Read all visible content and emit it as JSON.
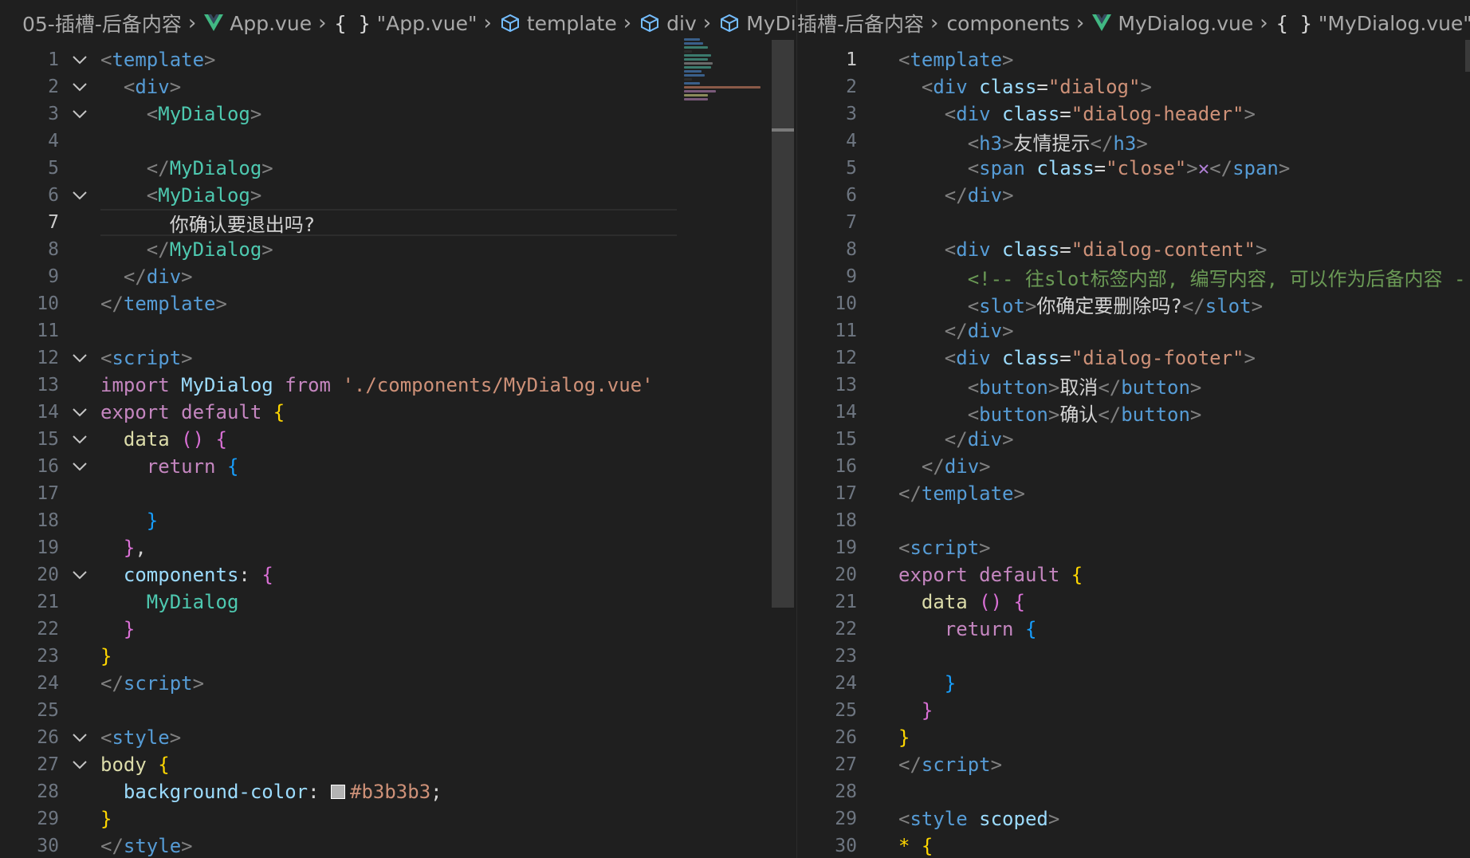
{
  "left": {
    "breadcrumbs": [
      "05-插槽-后备内容",
      "App.vue",
      "\"App.vue\"",
      "template",
      "div",
      "MyDi"
    ],
    "current_line": 7
  },
  "right": {
    "breadcrumbs": [
      "插槽-后备内容",
      "components",
      "MyDialog.vue",
      "\"MyDialog.vue\""
    ],
    "current_line": 1
  },
  "swatch_color": "#b3b3b3",
  "colors": {
    "background": "#1f1f1f",
    "line_number": "#6e7681",
    "tag": "#569cd6",
    "component": "#4ec9b0",
    "attribute": "#9cdcfe",
    "string": "#ce9178",
    "keyword": "#c586c0",
    "comment": "#6a9955"
  },
  "left_lines": [
    {
      "n": "1",
      "fold": true,
      "tokens": [
        [
          "t-punc",
          "<"
        ],
        [
          "t-tag",
          "template"
        ],
        [
          "t-punc",
          ">"
        ]
      ]
    },
    {
      "n": "2",
      "fold": true,
      "tokens": [
        [
          "t-white",
          "  "
        ],
        [
          "t-punc",
          "<"
        ],
        [
          "t-tag",
          "div"
        ],
        [
          "t-punc",
          ">"
        ]
      ]
    },
    {
      "n": "3",
      "fold": true,
      "tokens": [
        [
          "t-white",
          "    "
        ],
        [
          "t-punc",
          "<"
        ],
        [
          "t-comp",
          "MyDialog"
        ],
        [
          "t-punc",
          ">"
        ]
      ]
    },
    {
      "n": "4",
      "fold": false,
      "tokens": []
    },
    {
      "n": "5",
      "fold": false,
      "tokens": [
        [
          "t-white",
          "    "
        ],
        [
          "t-punc",
          "</"
        ],
        [
          "t-comp",
          "MyDialog"
        ],
        [
          "t-punc",
          ">"
        ]
      ]
    },
    {
      "n": "6",
      "fold": true,
      "tokens": [
        [
          "t-white",
          "    "
        ],
        [
          "t-punc",
          "<"
        ],
        [
          "t-comp",
          "MyDialog"
        ],
        [
          "t-punc",
          ">"
        ]
      ]
    },
    {
      "n": "7",
      "fold": false,
      "tokens": [
        [
          "t-white",
          "      "
        ],
        [
          "t-text",
          "你确认要退出吗?"
        ]
      ]
    },
    {
      "n": "8",
      "fold": false,
      "tokens": [
        [
          "t-white",
          "    "
        ],
        [
          "t-punc",
          "</"
        ],
        [
          "t-comp",
          "MyDialog"
        ],
        [
          "t-punc",
          ">"
        ]
      ]
    },
    {
      "n": "9",
      "fold": false,
      "tokens": [
        [
          "t-white",
          "  "
        ],
        [
          "t-punc",
          "</"
        ],
        [
          "t-tag",
          "div"
        ],
        [
          "t-punc",
          ">"
        ]
      ]
    },
    {
      "n": "10",
      "fold": false,
      "tokens": [
        [
          "t-punc",
          "</"
        ],
        [
          "t-tag",
          "template"
        ],
        [
          "t-punc",
          ">"
        ]
      ]
    },
    {
      "n": "11",
      "fold": false,
      "tokens": []
    },
    {
      "n": "12",
      "fold": true,
      "tokens": [
        [
          "t-punc",
          "<"
        ],
        [
          "t-tag",
          "script"
        ],
        [
          "t-punc",
          ">"
        ]
      ]
    },
    {
      "n": "13",
      "fold": false,
      "tokens": [
        [
          "t-kw",
          "import "
        ],
        [
          "t-attr",
          "MyDialog "
        ],
        [
          "t-kw",
          "from "
        ],
        [
          "t-str",
          "'./components/MyDialog.vue'"
        ]
      ]
    },
    {
      "n": "14",
      "fold": true,
      "tokens": [
        [
          "t-kw",
          "export default "
        ],
        [
          "t-b1",
          "{"
        ]
      ]
    },
    {
      "n": "15",
      "fold": true,
      "tokens": [
        [
          "t-white",
          "  "
        ],
        [
          "t-fn",
          "data "
        ],
        [
          "t-b2",
          "()"
        ],
        [
          "t-white",
          " "
        ],
        [
          "t-b2",
          "{"
        ]
      ]
    },
    {
      "n": "16",
      "fold": true,
      "tokens": [
        [
          "t-white",
          "    "
        ],
        [
          "t-kw",
          "return "
        ],
        [
          "t-b3",
          "{"
        ]
      ]
    },
    {
      "n": "17",
      "fold": false,
      "tokens": []
    },
    {
      "n": "18",
      "fold": false,
      "tokens": [
        [
          "t-white",
          "    "
        ],
        [
          "t-b3",
          "}"
        ]
      ]
    },
    {
      "n": "19",
      "fold": false,
      "tokens": [
        [
          "t-white",
          "  "
        ],
        [
          "t-b2",
          "}"
        ],
        [
          "t-white",
          ","
        ]
      ]
    },
    {
      "n": "20",
      "fold": true,
      "tokens": [
        [
          "t-white",
          "  "
        ],
        [
          "t-prop",
          "components"
        ],
        [
          "t-white",
          ": "
        ],
        [
          "t-b2",
          "{"
        ]
      ]
    },
    {
      "n": "21",
      "fold": false,
      "tokens": [
        [
          "t-white",
          "    "
        ],
        [
          "t-comp",
          "MyDialog"
        ]
      ]
    },
    {
      "n": "22",
      "fold": false,
      "tokens": [
        [
          "t-white",
          "  "
        ],
        [
          "t-b2",
          "}"
        ]
      ]
    },
    {
      "n": "23",
      "fold": false,
      "tokens": [
        [
          "t-b1",
          "}"
        ]
      ]
    },
    {
      "n": "24",
      "fold": false,
      "tokens": [
        [
          "t-punc",
          "</"
        ],
        [
          "t-tag",
          "script"
        ],
        [
          "t-punc",
          ">"
        ]
      ]
    },
    {
      "n": "25",
      "fold": false,
      "tokens": []
    },
    {
      "n": "26",
      "fold": true,
      "tokens": [
        [
          "t-punc",
          "<"
        ],
        [
          "t-tag",
          "style"
        ],
        [
          "t-punc",
          ">"
        ]
      ]
    },
    {
      "n": "27",
      "fold": true,
      "tokens": [
        [
          "t-fn",
          "body "
        ],
        [
          "t-b1",
          "{"
        ]
      ]
    },
    {
      "n": "28",
      "fold": false,
      "tokens": [
        [
          "t-white",
          "  "
        ],
        [
          "t-prop",
          "background-color"
        ],
        [
          "t-white",
          ": "
        ],
        [
          "swatch",
          ""
        ],
        [
          "t-str",
          "#b3b3b3"
        ],
        [
          "t-white",
          ";"
        ]
      ]
    },
    {
      "n": "29",
      "fold": false,
      "tokens": [
        [
          "t-b1",
          "}"
        ]
      ]
    },
    {
      "n": "30",
      "fold": false,
      "tokens": [
        [
          "t-punc",
          "</"
        ],
        [
          "t-tag",
          "style"
        ],
        [
          "t-punc",
          ">"
        ]
      ]
    }
  ],
  "right_lines": [
    {
      "n": "1",
      "tokens": [
        [
          "t-punc",
          "<"
        ],
        [
          "t-tag",
          "template"
        ],
        [
          "t-punc",
          ">"
        ]
      ]
    },
    {
      "n": "2",
      "tokens": [
        [
          "t-white",
          "  "
        ],
        [
          "t-punc",
          "<"
        ],
        [
          "t-tag",
          "div "
        ],
        [
          "t-attr",
          "class"
        ],
        [
          "t-white",
          "="
        ],
        [
          "t-str",
          "\"dialog\""
        ],
        [
          "t-punc",
          ">"
        ]
      ]
    },
    {
      "n": "3",
      "tokens": [
        [
          "t-white",
          "    "
        ],
        [
          "t-punc",
          "<"
        ],
        [
          "t-tag",
          "div "
        ],
        [
          "t-attr",
          "class"
        ],
        [
          "t-white",
          "="
        ],
        [
          "t-str",
          "\"dialog-header\""
        ],
        [
          "t-punc",
          ">"
        ]
      ]
    },
    {
      "n": "4",
      "tokens": [
        [
          "t-white",
          "      "
        ],
        [
          "t-punc",
          "<"
        ],
        [
          "t-tag",
          "h3"
        ],
        [
          "t-punc",
          ">"
        ],
        [
          "t-text",
          "友情提示"
        ],
        [
          "t-punc",
          "</"
        ],
        [
          "t-tag",
          "h3"
        ],
        [
          "t-punc",
          ">"
        ]
      ]
    },
    {
      "n": "5",
      "tokens": [
        [
          "t-white",
          "      "
        ],
        [
          "t-punc",
          "<"
        ],
        [
          "t-tag",
          "span "
        ],
        [
          "t-attr",
          "class"
        ],
        [
          "t-white",
          "="
        ],
        [
          "t-str",
          "\"close\""
        ],
        [
          "t-punc",
          ">"
        ],
        [
          "t-close",
          "✕"
        ],
        [
          "t-punc",
          "</"
        ],
        [
          "t-tag",
          "span"
        ],
        [
          "t-punc",
          ">"
        ]
      ]
    },
    {
      "n": "6",
      "tokens": [
        [
          "t-white",
          "    "
        ],
        [
          "t-punc",
          "</"
        ],
        [
          "t-tag",
          "div"
        ],
        [
          "t-punc",
          ">"
        ]
      ]
    },
    {
      "n": "7",
      "tokens": []
    },
    {
      "n": "8",
      "tokens": [
        [
          "t-white",
          "    "
        ],
        [
          "t-punc",
          "<"
        ],
        [
          "t-tag",
          "div "
        ],
        [
          "t-attr",
          "class"
        ],
        [
          "t-white",
          "="
        ],
        [
          "t-str",
          "\"dialog-content\""
        ],
        [
          "t-punc",
          ">"
        ]
      ]
    },
    {
      "n": "9",
      "tokens": [
        [
          "t-white",
          "      "
        ],
        [
          "t-cmt",
          "<!-- 往slot标签内部, 编写内容, 可以作为后备内容 -"
        ]
      ]
    },
    {
      "n": "10",
      "tokens": [
        [
          "t-white",
          "      "
        ],
        [
          "t-punc",
          "<"
        ],
        [
          "t-tag",
          "slot"
        ],
        [
          "t-punc",
          ">"
        ],
        [
          "t-text",
          "你确定要删除吗?"
        ],
        [
          "t-punc",
          "</"
        ],
        [
          "t-tag",
          "slot"
        ],
        [
          "t-punc",
          ">"
        ]
      ]
    },
    {
      "n": "11",
      "tokens": [
        [
          "t-white",
          "    "
        ],
        [
          "t-punc",
          "</"
        ],
        [
          "t-tag",
          "div"
        ],
        [
          "t-punc",
          ">"
        ]
      ]
    },
    {
      "n": "12",
      "tokens": [
        [
          "t-white",
          "    "
        ],
        [
          "t-punc",
          "<"
        ],
        [
          "t-tag",
          "div "
        ],
        [
          "t-attr",
          "class"
        ],
        [
          "t-white",
          "="
        ],
        [
          "t-str",
          "\"dialog-footer\""
        ],
        [
          "t-punc",
          ">"
        ]
      ]
    },
    {
      "n": "13",
      "tokens": [
        [
          "t-white",
          "      "
        ],
        [
          "t-punc",
          "<"
        ],
        [
          "t-tag",
          "button"
        ],
        [
          "t-punc",
          ">"
        ],
        [
          "t-text",
          "取消"
        ],
        [
          "t-punc",
          "</"
        ],
        [
          "t-tag",
          "button"
        ],
        [
          "t-punc",
          ">"
        ]
      ]
    },
    {
      "n": "14",
      "tokens": [
        [
          "t-white",
          "      "
        ],
        [
          "t-punc",
          "<"
        ],
        [
          "t-tag",
          "button"
        ],
        [
          "t-punc",
          ">"
        ],
        [
          "t-text",
          "确认"
        ],
        [
          "t-punc",
          "</"
        ],
        [
          "t-tag",
          "button"
        ],
        [
          "t-punc",
          ">"
        ]
      ]
    },
    {
      "n": "15",
      "tokens": [
        [
          "t-white",
          "    "
        ],
        [
          "t-punc",
          "</"
        ],
        [
          "t-tag",
          "div"
        ],
        [
          "t-punc",
          ">"
        ]
      ]
    },
    {
      "n": "16",
      "tokens": [
        [
          "t-white",
          "  "
        ],
        [
          "t-punc",
          "</"
        ],
        [
          "t-tag",
          "div"
        ],
        [
          "t-punc",
          ">"
        ]
      ]
    },
    {
      "n": "17",
      "tokens": [
        [
          "t-punc",
          "</"
        ],
        [
          "t-tag",
          "template"
        ],
        [
          "t-punc",
          ">"
        ]
      ]
    },
    {
      "n": "18",
      "tokens": []
    },
    {
      "n": "19",
      "tokens": [
        [
          "t-punc",
          "<"
        ],
        [
          "t-tag",
          "script"
        ],
        [
          "t-punc",
          ">"
        ]
      ]
    },
    {
      "n": "20",
      "tokens": [
        [
          "t-kw",
          "export default "
        ],
        [
          "t-b1",
          "{"
        ]
      ]
    },
    {
      "n": "21",
      "tokens": [
        [
          "t-white",
          "  "
        ],
        [
          "t-fn",
          "data "
        ],
        [
          "t-b2",
          "()"
        ],
        [
          "t-white",
          " "
        ],
        [
          "t-b2",
          "{"
        ]
      ]
    },
    {
      "n": "22",
      "tokens": [
        [
          "t-white",
          "    "
        ],
        [
          "t-kw",
          "return "
        ],
        [
          "t-b3",
          "{"
        ]
      ]
    },
    {
      "n": "23",
      "tokens": []
    },
    {
      "n": "24",
      "tokens": [
        [
          "t-white",
          "    "
        ],
        [
          "t-b3",
          "}"
        ]
      ]
    },
    {
      "n": "25",
      "tokens": [
        [
          "t-white",
          "  "
        ],
        [
          "t-b2",
          "}"
        ]
      ]
    },
    {
      "n": "26",
      "tokens": [
        [
          "t-b1",
          "}"
        ]
      ]
    },
    {
      "n": "27",
      "tokens": [
        [
          "t-punc",
          "</"
        ],
        [
          "t-tag",
          "script"
        ],
        [
          "t-punc",
          ">"
        ]
      ]
    },
    {
      "n": "28",
      "tokens": []
    },
    {
      "n": "29",
      "tokens": [
        [
          "t-punc",
          "<"
        ],
        [
          "t-tag",
          "style "
        ],
        [
          "t-attr",
          "scoped"
        ],
        [
          "t-punc",
          ">"
        ]
      ]
    },
    {
      "n": "30",
      "tokens": [
        [
          "t-b1",
          "* {"
        ]
      ]
    }
  ]
}
